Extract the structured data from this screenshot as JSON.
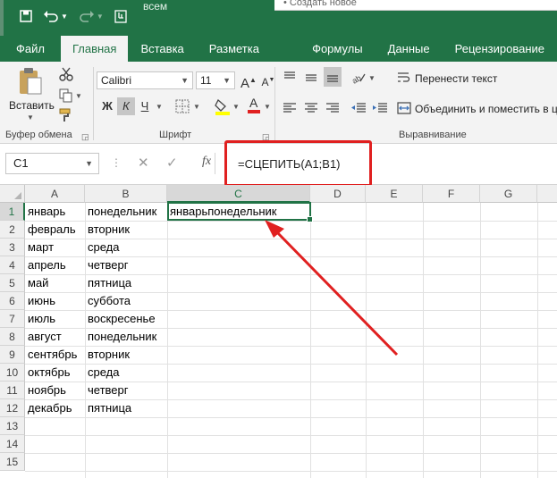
{
  "title_fragment": "всем",
  "right_panel_text": "• Создать новое",
  "tabs": [
    {
      "label": "Файл"
    },
    {
      "label": "Главная"
    },
    {
      "label": "Вставка"
    },
    {
      "label": "Разметка страницы"
    },
    {
      "label": "Формулы"
    },
    {
      "label": "Данные"
    },
    {
      "label": "Рецензирование"
    }
  ],
  "ribbon": {
    "paste_label": "Вставить",
    "clipboard_group": "Буфер обмена",
    "font_group": "Шрифт",
    "alignment_group": "Выравнивание",
    "font_name": "Calibri",
    "font_size": "11",
    "bold": "Ж",
    "italic": "К",
    "underline": "Ч",
    "wrap_text": "Перенести текст",
    "merge_center": "Объединить и поместить в ц"
  },
  "formula_bar": {
    "name_box": "C1",
    "fx": "fx",
    "formula": "=СЦЕПИТЬ(A1;B1)"
  },
  "columns": [
    "A",
    "B",
    "C",
    "D",
    "E",
    "F",
    "G"
  ],
  "rows": [
    "1",
    "2",
    "3",
    "4",
    "5",
    "6",
    "7",
    "8",
    "9",
    "10",
    "11",
    "12",
    "13",
    "14",
    "15"
  ],
  "cells": {
    "A": [
      "январь",
      "февраль",
      "март",
      "апрель",
      "май",
      "июнь",
      "июль",
      "август",
      "сентябрь",
      "октябрь",
      "ноябрь",
      "декабрь"
    ],
    "B": [
      "понедельник",
      "вторник",
      "среда",
      "четверг",
      "пятница",
      "суббота",
      "воскресенье",
      "понедельник",
      "вторник",
      "среда",
      "четверг",
      "пятница"
    ],
    "C1": "январьпонедельник"
  },
  "colors": {
    "accent": "#217346",
    "annotation": "#e02020"
  }
}
